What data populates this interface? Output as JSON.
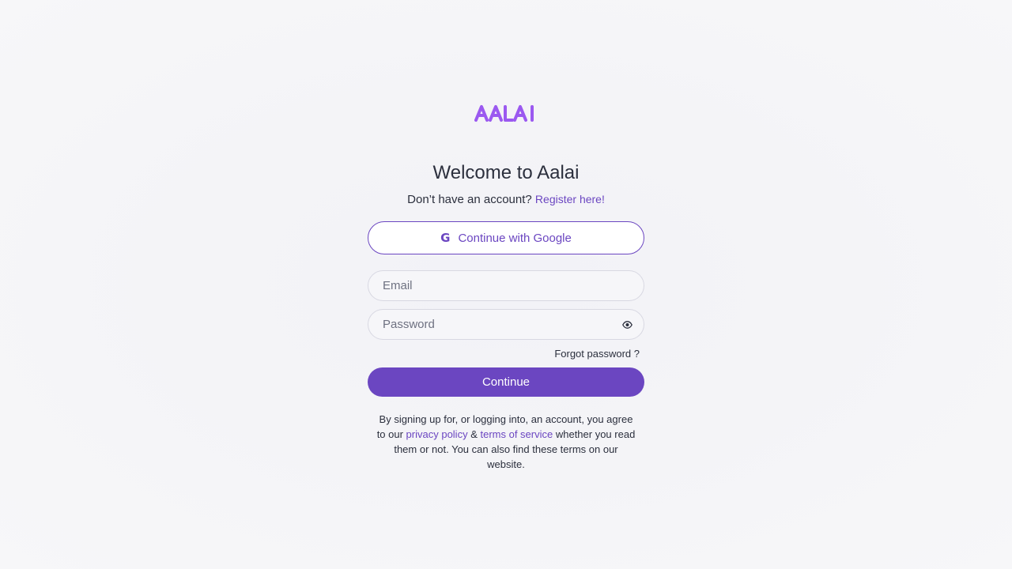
{
  "brand": {
    "logo_text": "AALAI",
    "logo_color": "#9b59f0"
  },
  "header": {
    "title": "Welcome to Aalai",
    "subtitle_prefix": "Don’t have an account? ",
    "register_link": "Register here!"
  },
  "google": {
    "icon_letter": "G",
    "label": "Continue with Google"
  },
  "form": {
    "email_placeholder": "Email",
    "email_value": "",
    "password_placeholder": "Password",
    "password_value": "",
    "password_toggle_icon": "eye-icon",
    "forgot_label": "Forgot password ?",
    "continue_label": "Continue"
  },
  "terms": {
    "part1": "By signing up for, or logging into, an account, you agree to our ",
    "privacy_link": "privacy policy",
    "part2": " & ",
    "tos_link": "terms of service",
    "part3": " whether you read them or not. You can also find these terms on our website."
  },
  "colors": {
    "accent": "#6b46c1",
    "text": "#2b2f3d",
    "background": "#f4f4f7"
  }
}
